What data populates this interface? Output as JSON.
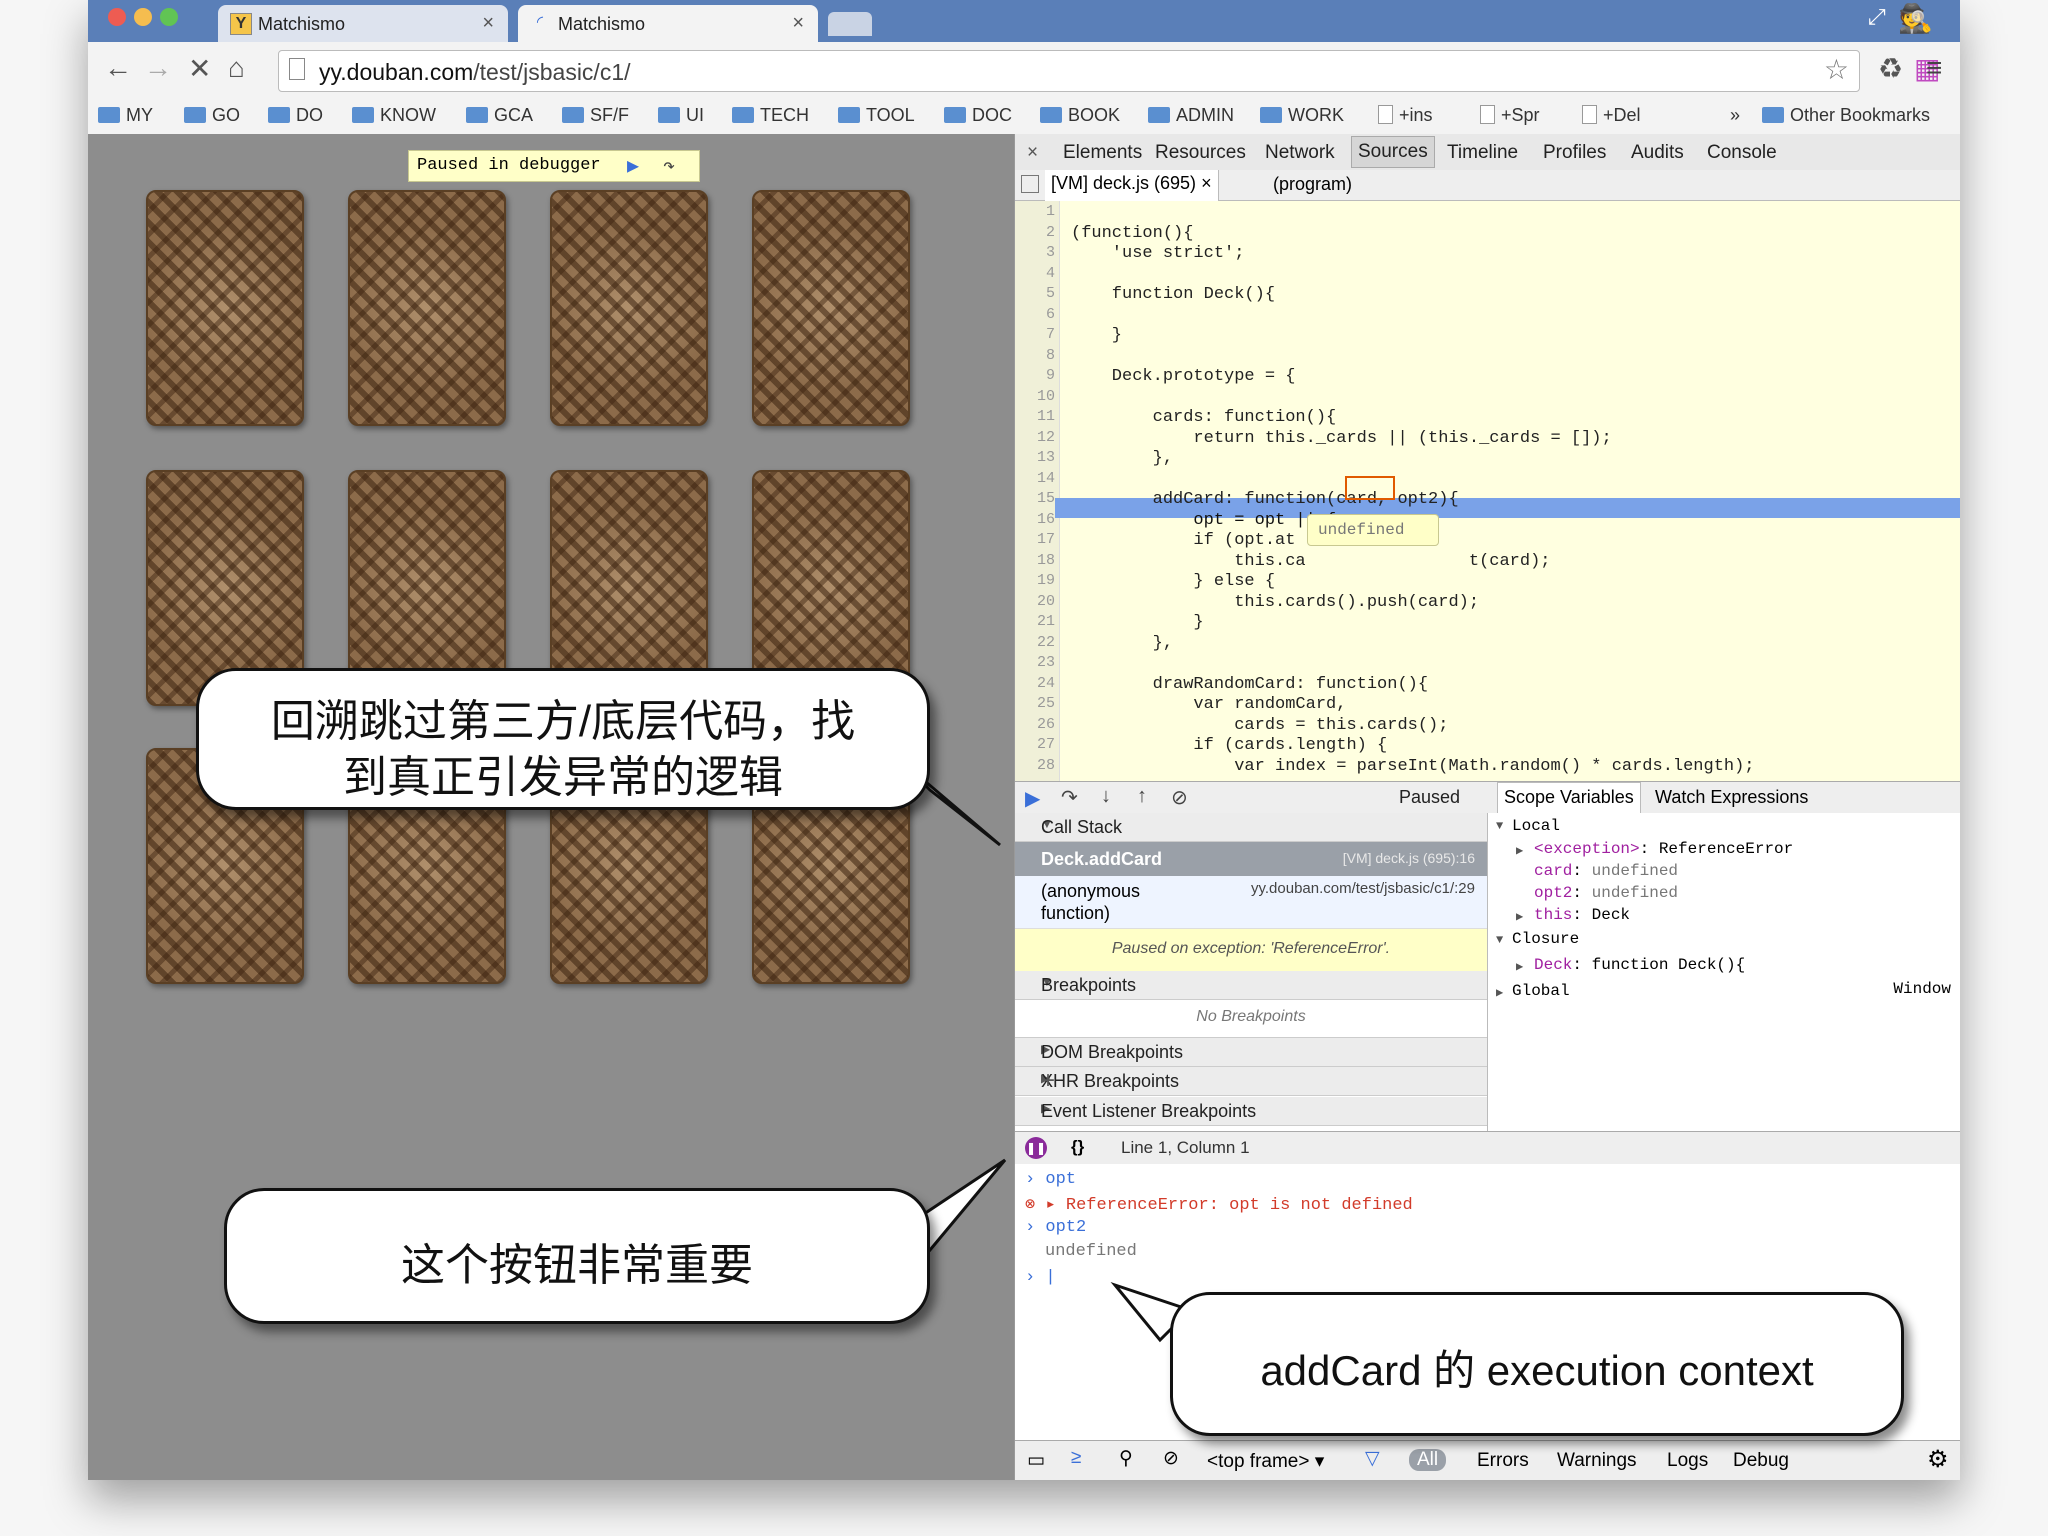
{
  "browser": {
    "tabs": [
      {
        "favicon": "Y",
        "title": "Matchismo"
      },
      {
        "favicon": "C",
        "title": "Matchismo"
      }
    ],
    "url_host": "yy.douban.com",
    "url_path": "/test/jsbasic/c1/",
    "bookmarks": [
      {
        "label": "MY",
        "type": "folder"
      },
      {
        "label": "GO",
        "type": "folder"
      },
      {
        "label": "DO",
        "type": "folder"
      },
      {
        "label": "KNOW",
        "type": "folder"
      },
      {
        "label": "GCA",
        "type": "folder"
      },
      {
        "label": "SF/F",
        "type": "folder"
      },
      {
        "label": "UI",
        "type": "folder"
      },
      {
        "label": "TECH",
        "type": "folder"
      },
      {
        "label": "TOOL",
        "type": "folder"
      },
      {
        "label": "DOC",
        "type": "folder"
      },
      {
        "label": "BOOK",
        "type": "folder"
      },
      {
        "label": "ADMIN",
        "type": "folder"
      },
      {
        "label": "WORK",
        "type": "folder"
      },
      {
        "label": "+ins",
        "type": "page"
      },
      {
        "label": "+Spr",
        "type": "page"
      },
      {
        "label": "+Del",
        "type": "page"
      }
    ],
    "bookmarks_more": "»",
    "other_bookmarks": "Other Bookmarks"
  },
  "page": {
    "paused_label": "Paused in debugger",
    "card_count": 12
  },
  "devtools": {
    "close": "×",
    "tabs": [
      "Elements",
      "Resources",
      "Network",
      "Sources",
      "Timeline",
      "Profiles",
      "Audits",
      "Console"
    ],
    "active_tab": "Sources",
    "file_tab": "[VM] deck.js (695)",
    "file_tab_close": "×",
    "program_tab": "(program)",
    "code_lines": [
      "",
      "(function(){",
      "    'use strict';",
      "",
      "    function Deck(){",
      "",
      "    }",
      "",
      "    Deck.prototype = {",
      "",
      "        cards: function(){",
      "            return this._cards || (this._cards = []);",
      "        },",
      "",
      "        addCard: function(card, opt2){",
      "            opt = opt || {",
      "            if (opt.at",
      "                this.ca                t(card);",
      "            } else {",
      "                this.cards().push(card);",
      "            }",
      "        },",
      "",
      "        drawRandomCard: function(){",
      "            var randomCard,",
      "                cards = this.cards();",
      "            if (cards.length) {",
      "                var index = parseInt(Math.random() * cards.length);"
    ],
    "tooltip": "undefined",
    "debugger_status": "Paused",
    "call_stack_label": "Call Stack",
    "call_stack": [
      {
        "fn": "Deck.addCard",
        "loc": "[VM] deck.js (695):16"
      },
      {
        "fn": "(anonymous function)",
        "loc": "yy.douban.com/test/jsbasic/c1/:29"
      }
    ],
    "exception_msg": "Paused on exception: 'ReferenceError'.",
    "breakpoints_label": "Breakpoints",
    "no_breakpoints": "No Breakpoints",
    "dom_breakpoints": "DOM Breakpoints",
    "xhr_breakpoints": "XHR Breakpoints",
    "xhr_add": "+",
    "event_breakpoints": "Event Listener Breakpoints",
    "scope_tab": "Scope Variables",
    "watch_tab": "Watch Expressions",
    "scope": {
      "local": "Local",
      "exception_key": "<exception>",
      "exception_val": "ReferenceError",
      "card_key": "card",
      "card_val": "undefined",
      "opt2_key": "opt2",
      "opt2_val": "undefined",
      "this_key": "this",
      "this_val": "Deck",
      "closure": "Closure",
      "deck_key": "Deck",
      "deck_val": "function Deck(){",
      "global": "Global",
      "global_val": "Window"
    },
    "status_braces": "{}",
    "status_position": "Line 1, Column 1",
    "console": {
      "in1": "opt",
      "err": "ReferenceError: opt is not defined",
      "in2": "opt2",
      "out2": "undefined"
    },
    "bottom": {
      "frame": "<top frame>",
      "all": "All",
      "errors": "Errors",
      "warnings": "Warnings",
      "logs": "Logs",
      "debug": "Debug"
    }
  },
  "callouts": {
    "c1_line1": "回溯跳过第三方/底层代码，找",
    "c1_line2": "到真正引发异常的逻辑",
    "c2": "这个按钮非常重要",
    "c3": "addCard 的 execution context"
  },
  "colors": {
    "tabstrip": "#5a7fb8",
    "highlight": "#7aa2e8",
    "editor_bg": "#ffffe0",
    "error": "#d23b2a"
  }
}
